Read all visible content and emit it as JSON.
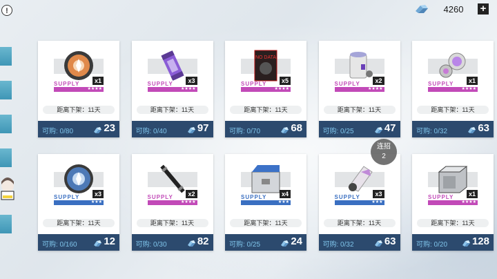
{
  "currency": {
    "value": "4260",
    "add": "+",
    "icon": "pyroxene-icon"
  },
  "info": {
    "label": "!"
  },
  "combo": {
    "label": "连招",
    "count": "2"
  },
  "colors": {
    "purple": "#c24ab8",
    "blue": "#3a6fc1",
    "card_bottom": "#2c4a6e",
    "buy_text": "#7fc4ea"
  },
  "items": [
    {
      "icon": "orange-disc-icon",
      "supply": "SUPPLY",
      "qty": "x1",
      "stars": "★★★★",
      "rarity": "purple",
      "expire": "距离下架：11天",
      "buy": "可购: 0/80",
      "price": "23"
    },
    {
      "icon": "purple-canister-icon",
      "supply": "SUPPLY",
      "qty": "x3",
      "stars": "★★★★",
      "rarity": "purple",
      "expire": "距离下架：11天",
      "buy": "可购: 0/40",
      "price": "97"
    },
    {
      "icon": "nodata-book-icon",
      "supply": "SUPPLY",
      "qty": "x5",
      "stars": "★★★★",
      "rarity": "purple",
      "expire": "距离下架：11天",
      "buy": "可购: 0/70",
      "price": "68"
    },
    {
      "icon": "white-drum-icon",
      "supply": "SUPPLY",
      "qty": "x2",
      "stars": "★★★★",
      "rarity": "purple",
      "expire": "距离下架：11天",
      "buy": "可购: 0/25",
      "price": "47"
    },
    {
      "icon": "crystal-cylinder-icon",
      "supply": "SUPPLY",
      "qty": "x1",
      "stars": "★★★★",
      "rarity": "purple",
      "expire": "距离下架：11天",
      "buy": "可购: 0/32",
      "price": "63"
    },
    {
      "icon": "blue-disc-icon",
      "supply": "SUPPLY",
      "qty": "x3",
      "stars": "★★★",
      "rarity": "blue",
      "expire": "距离下架：11天",
      "buy": "可购: 0/160",
      "price": "12"
    },
    {
      "icon": "black-rod-icon",
      "supply": "SUPPLY",
      "qty": "x2",
      "stars": "★★★★",
      "rarity": "purple",
      "expire": "距离下架：11天",
      "buy": "可购: 0/30",
      "price": "82"
    },
    {
      "icon": "metal-box-icon",
      "supply": "SUPPLY",
      "qty": "x4",
      "stars": "★★★",
      "rarity": "blue",
      "expire": "距离下架：11天",
      "buy": "可购: 0/25",
      "price": "24"
    },
    {
      "icon": "crystal-horn-icon",
      "supply": "SUPPLY",
      "qty": "x3",
      "stars": "★★★",
      "rarity": "blue",
      "expire": "距离下架：11天",
      "buy": "可购: 0/32",
      "price": "63"
    },
    {
      "icon": "steel-crate-icon",
      "supply": "SUPPLY",
      "qty": "x1",
      "stars": "★★★★",
      "rarity": "purple",
      "expire": "距离下架：11天",
      "buy": "可购: 0/20",
      "price": "128"
    }
  ]
}
